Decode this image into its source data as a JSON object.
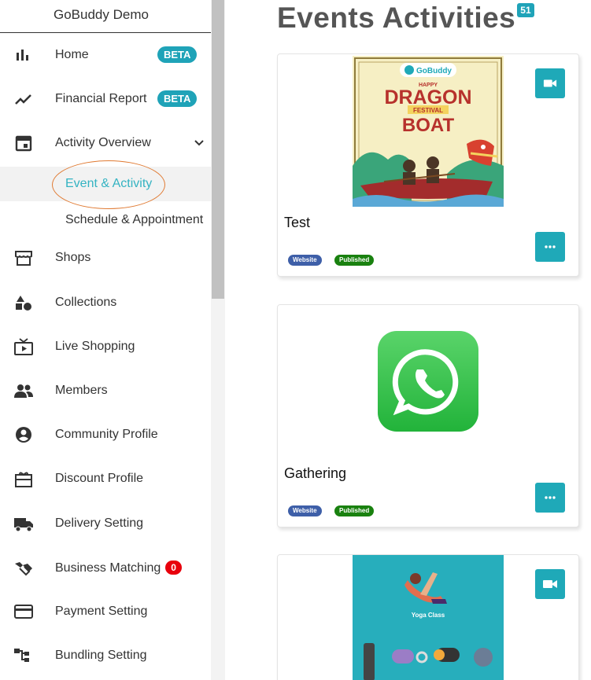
{
  "sidebar": {
    "title": "GoBuddy Demo",
    "items": [
      {
        "label": "Home",
        "icon": "bar-chart-icon",
        "badge": "BETA"
      },
      {
        "label": "Financial Report",
        "icon": "trending-icon",
        "badge": "BETA"
      },
      {
        "label": "Activity Overview",
        "icon": "calendar-icon"
      },
      {
        "label": "Shops",
        "icon": "storefront-icon"
      },
      {
        "label": "Collections",
        "icon": "shapes-icon"
      },
      {
        "label": "Live Shopping",
        "icon": "live-tv-icon"
      },
      {
        "label": "Members",
        "icon": "people-icon"
      },
      {
        "label": "Community Profile",
        "icon": "account-circle-icon"
      },
      {
        "label": "Discount Profile",
        "icon": "gift-card-icon"
      },
      {
        "label": "Delivery Setting",
        "icon": "truck-icon"
      },
      {
        "label": "Business Matching",
        "icon": "handshake-icon",
        "badge": "0"
      },
      {
        "label": "Payment Setting",
        "icon": "credit-card-icon"
      },
      {
        "label": "Bundling Setting",
        "icon": "hierarchy-icon"
      }
    ],
    "subitems": [
      {
        "label": "Event & Activity",
        "active": true
      },
      {
        "label": "Schedule & Appointment",
        "active": false
      }
    ]
  },
  "main": {
    "title": "Events Activities",
    "count": "51",
    "cards": [
      {
        "title": "Test",
        "tags": [
          "Website",
          "Published"
        ],
        "image": "dragon-boat-poster",
        "poster": {
          "brand": "GoBuddy",
          "line1": "HAPPY",
          "line2": "DRAGON",
          "line3": "FESTIVAL",
          "line4": "BOAT"
        }
      },
      {
        "title": "Gathering",
        "tags": [
          "Website",
          "Published"
        ],
        "image": "whatsapp-logo"
      },
      {
        "title": "",
        "tags": [],
        "image": "yoga-class-poster",
        "poster": {
          "caption": "Yoga Class"
        }
      }
    ]
  },
  "colors": {
    "accent": "#1fa9b8",
    "badge_red": "#e8000c",
    "website_tag": "#3e5fa8",
    "published_tag": "#19810f",
    "active_text": "#34b3c2"
  }
}
